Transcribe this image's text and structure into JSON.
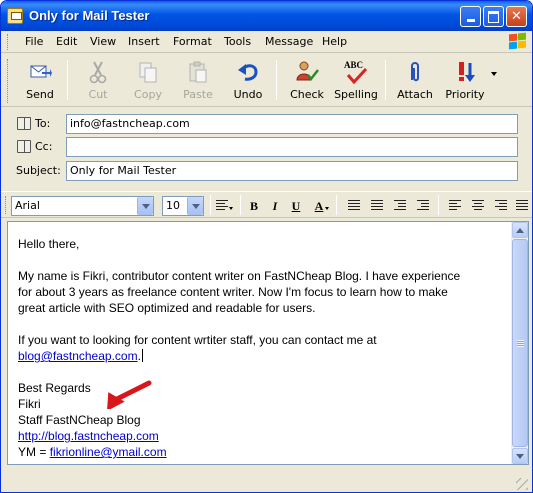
{
  "window": {
    "title": "Only for Mail Tester"
  },
  "menu": [
    "File",
    "Edit",
    "View",
    "Insert",
    "Format",
    "Tools",
    "Message",
    "Help"
  ],
  "toolbar": {
    "send": "Send",
    "cut": "Cut",
    "copy": "Copy",
    "paste": "Paste",
    "undo": "Undo",
    "check": "Check",
    "spelling": "Spelling",
    "spelling_icon_text": "ABC",
    "attach": "Attach",
    "priority": "Priority"
  },
  "header": {
    "to_label": "To:",
    "to_value": "info@fastncheap.com",
    "cc_label": "Cc:",
    "cc_value": "",
    "subject_label": "Subject:",
    "subject_value": "Only for Mail Tester"
  },
  "format": {
    "font": "Arial",
    "size": "10",
    "bold": "B",
    "italic": "I",
    "underline": "U",
    "font_color": "A"
  },
  "message": {
    "greeting": "Hello there,",
    "para1_line1": "My name is Fikri, contributor content writer on FastNCheap Blog. I have experience",
    "para1_line2": "for about 3 years as freelance content writer. Now I'm focus to learn how to make",
    "para1_line3": "great article with SEO optimized and readable for users.",
    "para2_line1": "If you want to looking for content wrtiter staff, you can contact me at",
    "para2_link": "blog@fastncheap.com",
    "para2_end": ".",
    "sig_regards": "Best Regards",
    "sig_name": "Fikri",
    "sig_title": "Staff FastNCheap Blog",
    "sig_url": "http://blog.fastncheap.com",
    "sig_ym_label": "YM = ",
    "sig_ym_link": "fikrionline@ymail.com"
  },
  "colors": {
    "titlebar": "#0055e5",
    "chrome": "#ece9d8",
    "link": "#0000cc",
    "arrow": "#d9161b"
  }
}
